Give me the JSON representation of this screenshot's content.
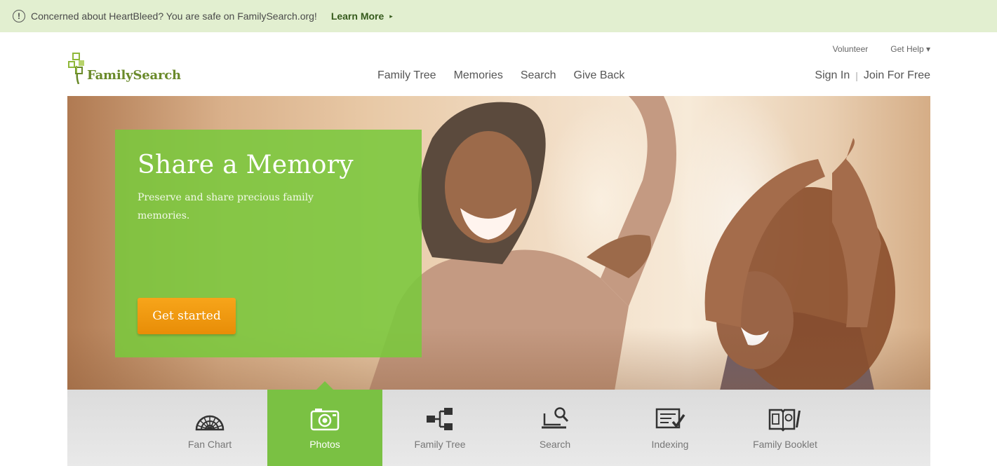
{
  "alert": {
    "icon": "!",
    "message": "Concerned about HeartBleed? You are safe on FamilySearch.org!",
    "link_label": "Learn More",
    "link_arrow": "▸"
  },
  "header": {
    "logo_text": "FamilySearch",
    "util_nav": {
      "volunteer": "Volunteer",
      "get_help": "Get Help ▾"
    },
    "main_nav": [
      "Family Tree",
      "Memories",
      "Search",
      "Give Back"
    ],
    "sign_in": "Sign In",
    "separator": "|",
    "join": "Join For Free"
  },
  "hero": {
    "title": "Share a Memory",
    "description": "Preserve and share precious family memories.",
    "cta_label": "Get started"
  },
  "features": {
    "items": [
      {
        "label": "Fan Chart",
        "icon": "fan-chart-icon"
      },
      {
        "label": "Photos",
        "icon": "camera-icon",
        "active": true
      },
      {
        "label": "Family Tree",
        "icon": "tree-chart-icon"
      },
      {
        "label": "Search",
        "icon": "search-computer-icon"
      },
      {
        "label": "Indexing",
        "icon": "indexing-icon"
      },
      {
        "label": "Family Booklet",
        "icon": "booklet-icon"
      }
    ]
  },
  "colors": {
    "brand_green": "#7ac143",
    "alert_bg": "#e2efd0",
    "cta_orange": "#f7a51a"
  }
}
